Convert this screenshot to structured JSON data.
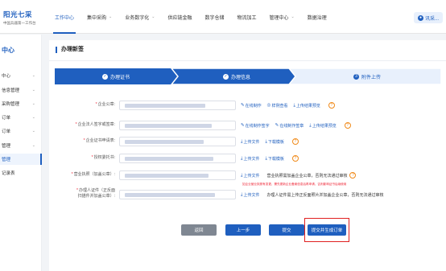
{
  "brand": {
    "name": "阳光七采",
    "tagline": "中国兵器第一工作台"
  },
  "nav": {
    "items": [
      {
        "label": "工作中心",
        "active": true,
        "has_menu": false
      },
      {
        "label": "集中采购",
        "active": false,
        "has_menu": true
      },
      {
        "label": "业务数字化",
        "active": false,
        "has_menu": true
      },
      {
        "label": "供应链金融",
        "active": false,
        "has_menu": false
      },
      {
        "label": "数字仓储",
        "active": false,
        "has_menu": false
      },
      {
        "label": "物流加工",
        "active": false,
        "has_menu": false
      },
      {
        "label": "管理中心",
        "active": false,
        "has_menu": true
      },
      {
        "label": "数据治理",
        "active": false,
        "has_menu": false
      }
    ],
    "user_label": "讯采..."
  },
  "sidebar": {
    "title": "中心",
    "items": [
      {
        "label": "中心",
        "chevron": true,
        "active": false
      },
      {
        "label": "信息管理",
        "chevron": true,
        "active": false
      },
      {
        "label": "采购管理",
        "chevron": true,
        "active": false
      },
      {
        "label": "订单",
        "chevron": true,
        "active": false
      },
      {
        "label": "订单",
        "chevron": true,
        "active": false
      },
      {
        "label": "管理",
        "chevron": true,
        "active": false
      },
      {
        "label": "管理",
        "chevron": false,
        "active": true
      },
      {
        "label": "记录表",
        "chevron": false,
        "active": false
      }
    ]
  },
  "panel": {
    "title": "办理新签"
  },
  "steps": [
    {
      "num": "1",
      "label": "办理证书",
      "status": "done"
    },
    {
      "num": "2",
      "label": "办理信息",
      "status": "done"
    },
    {
      "num": "3",
      "label": "附件上传",
      "status": "current"
    }
  ],
  "form": {
    "rows": [
      {
        "label": "企业公章:",
        "required": true,
        "actions": [
          "在线制作",
          "样例查看",
          "上传结果预览"
        ],
        "help": true,
        "note": ""
      },
      {
        "label": "企业法人签字或签章:",
        "required": true,
        "actions": [
          "在线制作签字",
          "在线制作签章",
          "上传结果预览"
        ],
        "help": true,
        "note": ""
      },
      {
        "label": "企业证书申请表:",
        "required": true,
        "actions": [
          "上传文件",
          "下载模板"
        ],
        "help": true,
        "note": ""
      },
      {
        "label": "授权委托书:",
        "required": true,
        "actions": [
          "上传文件",
          "下载模板"
        ],
        "help": true,
        "note": ""
      },
      {
        "label": "营业执照（加盖公章）:",
        "required": true,
        "actions": [
          "上传文件"
        ],
        "help": true,
        "note": "营业执照需加盖企业公章，否则无法通过审核"
      },
      {
        "label": "办理人证件（正反面扫描件并加盖公章）:",
        "required": true,
        "actions": [
          "上传文件"
        ],
        "help": false,
        "note": "办理人证件需上传正反面照片并加盖企业公章，否则无法通过审核"
      }
    ],
    "warning": "如企业营业执照有变更，需先更新企业备案信息后再申请，否则影响证书后续使用"
  },
  "buttons": {
    "back": "返回",
    "prev": "上一步",
    "submit": "提交",
    "submit_generate": "提交并生成订单"
  },
  "colors": {
    "primary": "#1f5fbf",
    "step_todo_bg": "#e8f0fc",
    "danger": "#e02020",
    "help": "#f08a1a",
    "button_gray": "#7f8792"
  }
}
